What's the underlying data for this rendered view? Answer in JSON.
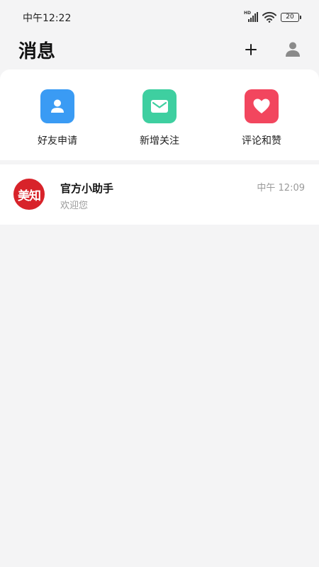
{
  "status_bar": {
    "time": "中午12:22",
    "network_badge": "HD",
    "battery": "20"
  },
  "header": {
    "title": "消息",
    "add_icon": "plus-icon",
    "profile_icon": "user-icon"
  },
  "quick_actions": [
    {
      "label": "好友申请",
      "icon": "user-icon",
      "color": "#3a9bf4"
    },
    {
      "label": "新增关注",
      "icon": "mail-icon",
      "color": "#3ecfa0"
    },
    {
      "label": "评论和赞",
      "icon": "heart-icon",
      "color": "#f2465e"
    }
  ],
  "messages": [
    {
      "avatar_text": "美知",
      "name": "官方小助手",
      "preview": "欢迎您",
      "time": "中午 12:09",
      "avatar_color": "#d8232a"
    }
  ]
}
